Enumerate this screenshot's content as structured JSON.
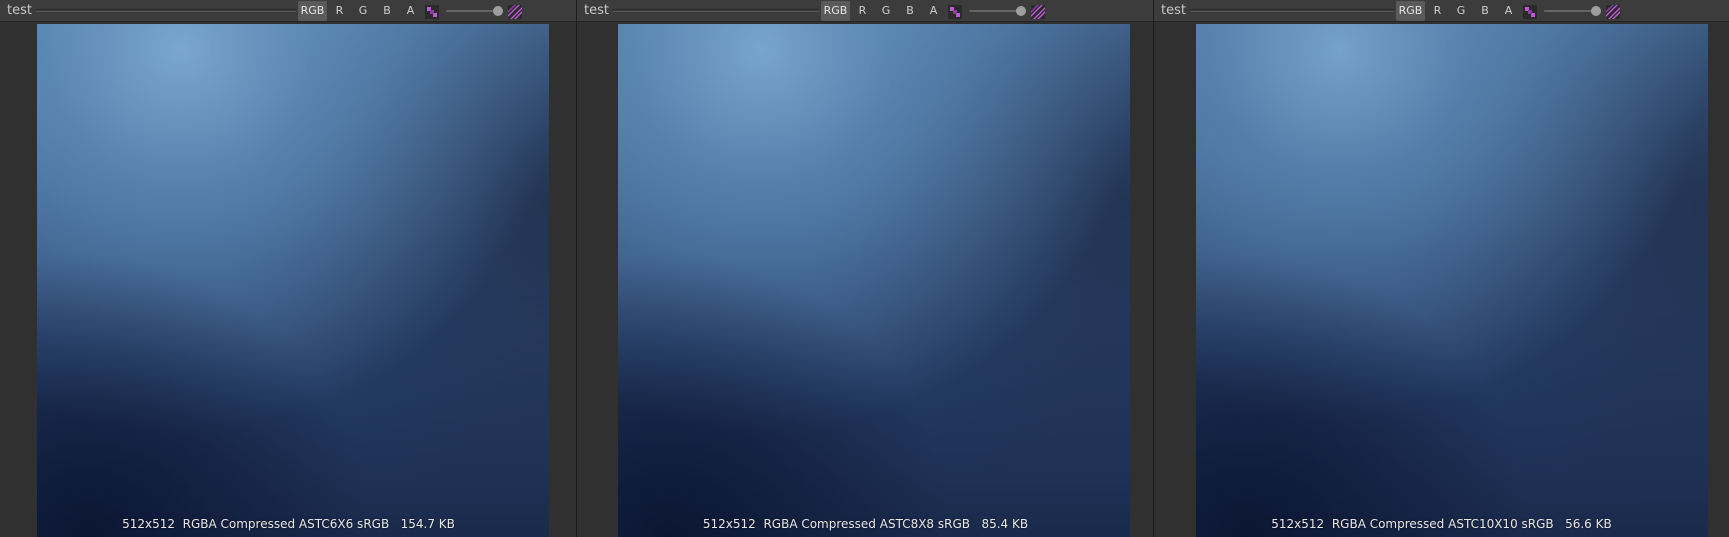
{
  "panes": [
    {
      "title": "test",
      "channels": [
        "RGB",
        "R",
        "G",
        "B",
        "A"
      ],
      "active_channel": "RGB",
      "caption": "512x512  RGBA Compressed ASTC6X6 sRGB   154.7 KB"
    },
    {
      "title": "test",
      "channels": [
        "RGB",
        "R",
        "G",
        "B",
        "A"
      ],
      "active_channel": "RGB",
      "caption": "512x512  RGBA Compressed ASTC8X8 sRGB   85.4 KB"
    },
    {
      "title": "test",
      "channels": [
        "RGB",
        "R",
        "G",
        "B",
        "A"
      ],
      "active_channel": "RGB",
      "caption": "512x512  RGBA Compressed ASTC10X10 sRGB   56.6 KB"
    }
  ],
  "icons": {
    "alpha_toggle": "checker-alpha-icon",
    "background_toggle": "checker-background-icon"
  },
  "mip_slider": {
    "value": 1.0
  },
  "colors": {
    "toolbar": "#3c3c3c",
    "active_button": "#5a5a5a",
    "icon_accent": "#b040c8",
    "image_light": "#6f9cc4",
    "image_dark": "#0f1b3a"
  }
}
